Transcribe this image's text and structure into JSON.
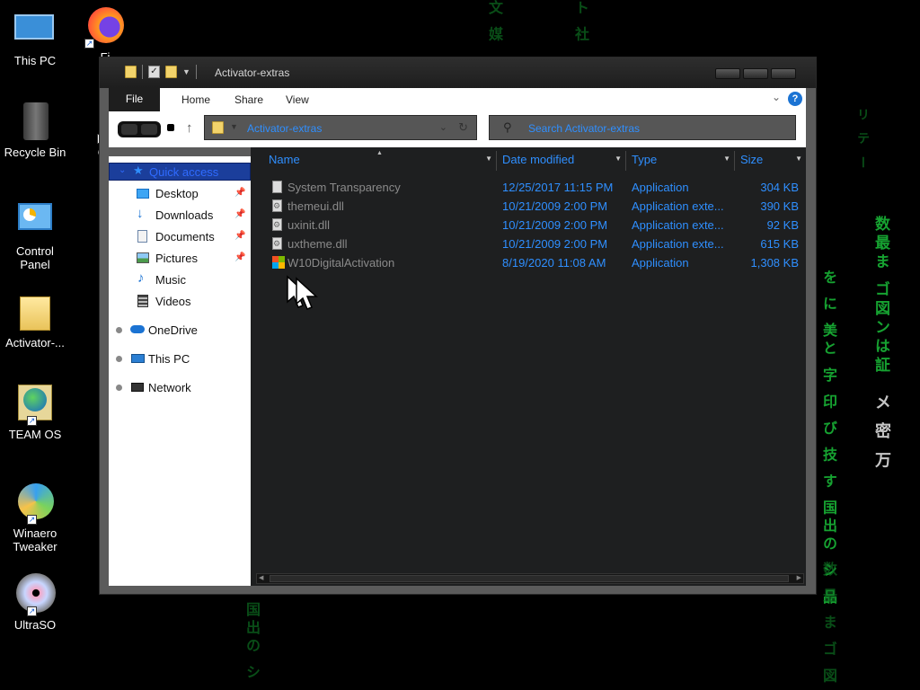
{
  "desktop": {
    "icons": [
      {
        "label": "This PC"
      },
      {
        "label": "Fi"
      },
      {
        "label": "Recycle Bin"
      },
      {
        "label": "Ca"
      },
      {
        "label": "Control Panel"
      },
      {
        "label": "Activator-..."
      },
      {
        "label": "TEAM OS"
      },
      {
        "label": "Winaero Tweaker"
      },
      {
        "label": "UltraSO"
      }
    ],
    "matrix_text": [
      "数最ま ゴ図ンは証",
      "を に 美と 字 印 び 技 す 国出の シ 品",
      "メ 密 万",
      "数 最 ま ゴ 図",
      "国出の シ",
      "文 媒",
      "ト 社"
    ]
  },
  "window": {
    "title": "Activator-extras",
    "ribbon_tabs": [
      "File",
      "Home",
      "Share",
      "View"
    ],
    "help": "?",
    "address_path": "Activator-extras",
    "search_placeholder": "Search Activator-extras",
    "nav": {
      "quick_access": "Quick access",
      "items": [
        {
          "label": "Desktop",
          "icon": "desktop-icon",
          "pinned": true
        },
        {
          "label": "Downloads",
          "icon": "download-arrow-icon",
          "pinned": true
        },
        {
          "label": "Documents",
          "icon": "document-icon",
          "pinned": true
        },
        {
          "label": "Pictures",
          "icon": "picture-icon",
          "pinned": true
        },
        {
          "label": "Music",
          "icon": "music-note-icon",
          "pinned": false
        },
        {
          "label": "Videos",
          "icon": "film-icon",
          "pinned": false
        }
      ],
      "onedrive": "OneDrive",
      "this_pc": "This PC",
      "network": "Network"
    },
    "columns": {
      "name": "Name",
      "date": "Date modified",
      "type": "Type",
      "size": "Size"
    },
    "files": [
      {
        "name": "System Transparency",
        "date": "12/25/2017 11:15 PM",
        "type": "Application",
        "size": "304 KB",
        "icon": "app-icon"
      },
      {
        "name": "themeui.dll",
        "date": "10/21/2009 2:00 PM",
        "type": "Application exte...",
        "size": "390 KB",
        "icon": "dll-icon"
      },
      {
        "name": "uxinit.dll",
        "date": "10/21/2009 2:00 PM",
        "type": "Application exte...",
        "size": "92 KB",
        "icon": "dll-icon"
      },
      {
        "name": "uxtheme.dll",
        "date": "10/21/2009 2:00 PM",
        "type": "Application exte...",
        "size": "615 KB",
        "icon": "dll-icon"
      },
      {
        "name": "W10DigitalActivation",
        "date": "8/19/2020 11:08 AM",
        "type": "Application",
        "size": "1,308 KB",
        "icon": "windows-logo-icon"
      }
    ]
  },
  "colors": {
    "accent_blue": "#2f8fff",
    "matrix_green": "#1bbf3a",
    "selection": "#1b3e9b"
  }
}
